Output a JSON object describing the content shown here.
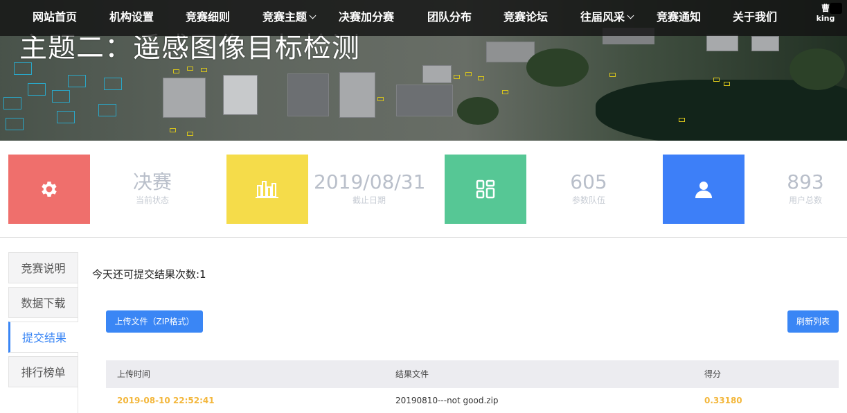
{
  "nav": {
    "items": [
      {
        "label": "网站首页",
        "dropdown": false
      },
      {
        "label": "机构设置",
        "dropdown": false
      },
      {
        "label": "竞赛细则",
        "dropdown": false
      },
      {
        "label": "竞赛主题",
        "dropdown": true
      },
      {
        "label": "决赛加分赛",
        "dropdown": false
      },
      {
        "label": "团队分布",
        "dropdown": false
      },
      {
        "label": "竞赛论坛",
        "dropdown": false
      },
      {
        "label": "往届风采",
        "dropdown": true
      },
      {
        "label": "竞赛通知",
        "dropdown": false
      },
      {
        "label": "关于我们",
        "dropdown": false
      }
    ],
    "user": {
      "name": "曹",
      "id": "king"
    }
  },
  "banner": {
    "title": "主题二：遥感图像目标检测"
  },
  "stats": [
    {
      "icon": "gear-icon",
      "color": "#ef6f6c",
      "value": "决赛",
      "label": "当前状态"
    },
    {
      "icon": "bar-chart-icon",
      "color": "#f5dc4a",
      "value": "2019/08/31",
      "label": "截止日期"
    },
    {
      "icon": "grid-icon",
      "color": "#56c795",
      "value": "605",
      "label": "参数队伍"
    },
    {
      "icon": "user-icon",
      "color": "#3d7ff8",
      "value": "893",
      "label": "用户总数"
    }
  ],
  "sidebar": {
    "items": [
      {
        "label": "竞赛说明",
        "active": false
      },
      {
        "label": "数据下载",
        "active": false
      },
      {
        "label": "提交结果",
        "active": true
      },
      {
        "label": "排行榜单",
        "active": false
      }
    ]
  },
  "submit": {
    "remaining_text": "今天还可提交结果次数:1",
    "upload_label": "上传文件（ZIP格式）",
    "refresh_label": "刷新列表"
  },
  "table": {
    "headers": [
      "上传时间",
      "结果文件",
      "得分"
    ],
    "rows": [
      {
        "time": "2019-08-10 22:52:41",
        "file": "20190810---not good.zip",
        "score": "0.33180"
      }
    ]
  },
  "colors": {
    "accent": "#3a86f5",
    "highlight": "#f3b63a"
  }
}
